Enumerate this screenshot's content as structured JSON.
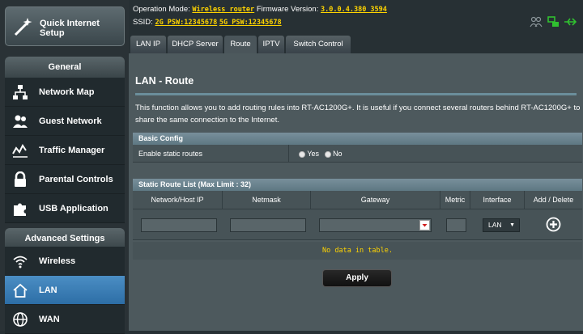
{
  "sidebar": {
    "quick_setup": "Quick Internet Setup",
    "general_header": "General",
    "general_items": [
      {
        "label": "Network Map",
        "icon": "network-map-icon"
      },
      {
        "label": "Guest Network",
        "icon": "guest-network-icon"
      },
      {
        "label": "Traffic Manager",
        "icon": "traffic-manager-icon"
      },
      {
        "label": "Parental Controls",
        "icon": "lock-icon"
      },
      {
        "label": "USB Application",
        "icon": "puzzle-icon"
      }
    ],
    "advanced_header": "Advanced Settings",
    "advanced_items": [
      {
        "label": "Wireless",
        "icon": "wifi-icon"
      },
      {
        "label": "LAN",
        "icon": "home-icon"
      },
      {
        "label": "WAN",
        "icon": "globe-icon"
      }
    ]
  },
  "header": {
    "opmode_label": "Operation Mode:",
    "opmode_value": "Wireless router",
    "fw_label": "Firmware Version:",
    "fw_value": "3.0.0.4.380_3594",
    "ssid_label": "SSID:",
    "ssid_2g": "2G_PSW:12345678",
    "ssid_5g": "5G_PSW:12345678"
  },
  "tabs": [
    "LAN IP",
    "DHCP Server",
    "Route",
    "IPTV",
    "Switch Control"
  ],
  "page": {
    "title": "LAN - Route",
    "description": "This function allows you to add routing rules into RT-AC1200G+. It is useful if you connect several routers behind RT-AC1200G+ to share the same connection to the Internet.",
    "basic_config_header": "Basic Config",
    "enable_static_label": "Enable static routes",
    "yes_label": "Yes",
    "no_label": "No",
    "static_list_header": "Static Route List (Max Limit : 32)",
    "columns": [
      "Network/Host IP",
      "Netmask",
      "Gateway",
      "Metric",
      "Interface",
      "Add / Delete"
    ],
    "interface_value": "LAN",
    "no_data": "No data in table.",
    "apply_label": "Apply"
  },
  "colors": {
    "accent": "#4b8ec4",
    "highlight_text": "#ffd400",
    "background": "#4d595d"
  }
}
